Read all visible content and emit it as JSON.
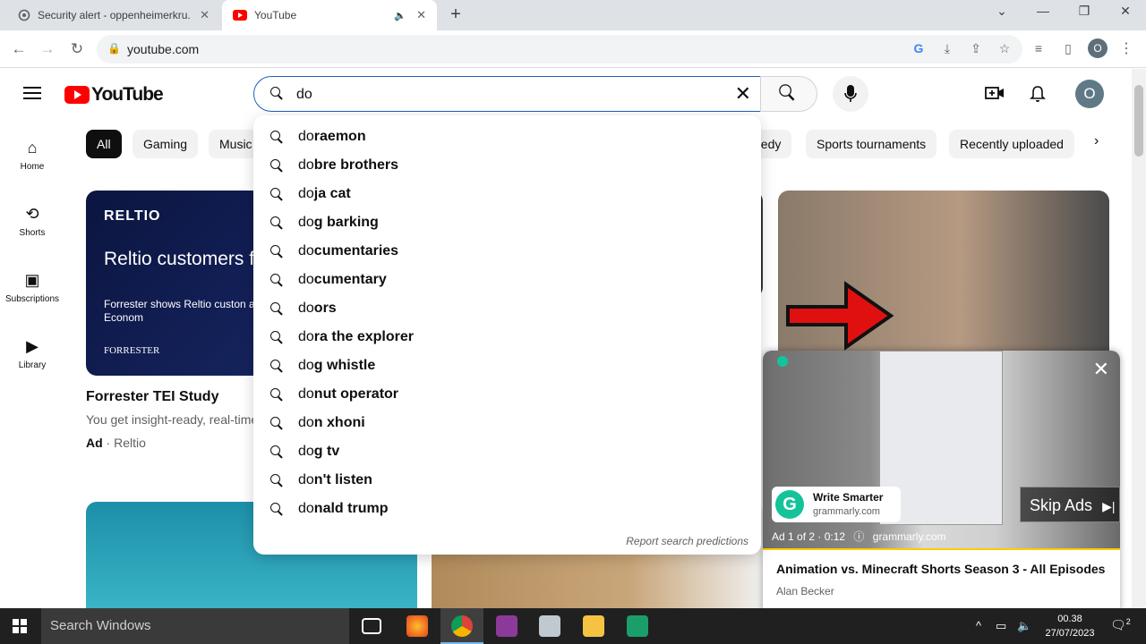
{
  "browser": {
    "tabs": [
      {
        "title": "Security alert - oppenheimerkru...",
        "active": false
      },
      {
        "title": "YouTube",
        "active": true
      }
    ],
    "url": "youtube.com",
    "profile_initial": "O"
  },
  "youtube": {
    "logo_text": "YouTube",
    "search_value": "do",
    "avatar_initial": "O",
    "sidenav": [
      {
        "label": "Home"
      },
      {
        "label": "Shorts"
      },
      {
        "label": "Subscriptions"
      },
      {
        "label": "Library"
      }
    ],
    "chips": [
      "All",
      "Gaming",
      "Music",
      "nedy",
      "Sports tournaments",
      "Recently uploaded"
    ],
    "suggestions": [
      {
        "prefix": "do",
        "rest": "raemon"
      },
      {
        "prefix": "do",
        "rest": "bre brothers"
      },
      {
        "prefix": "do",
        "rest": "ja cat"
      },
      {
        "prefix": "do",
        "rest": "g barking"
      },
      {
        "prefix": "do",
        "rest": "cumentaries"
      },
      {
        "prefix": "do",
        "rest": "cumentary"
      },
      {
        "prefix": "do",
        "rest": "ors"
      },
      {
        "prefix": "do",
        "rest": "ra the explorer"
      },
      {
        "prefix": "do",
        "rest": "g whistle"
      },
      {
        "prefix": "do",
        "rest": "nut operator"
      },
      {
        "prefix": "do",
        "rest": "n xhoni"
      },
      {
        "prefix": "do",
        "rest": "g tv"
      },
      {
        "prefix": "do",
        "rest": "n't listen"
      },
      {
        "prefix": "do",
        "rest": "nald trump"
      }
    ],
    "report_text": "Report search predictions",
    "ad_video": {
      "thumb_brand": "RELTIO",
      "thumb_headline": "Reltio customers from better accou",
      "thumb_sub": "Forrester shows Reltio custon and more in the Total Econom",
      "thumb_footer": "FORRESTER",
      "title": "Forrester TEI Study",
      "description": "You get insight-ready, real-time",
      "ad_label": "Ad",
      "advertiser": "Reltio"
    },
    "miniplayer": {
      "ad_brand": "Write Smarter",
      "ad_domain": "grammarly.com",
      "skip_label": "Skip Ads",
      "ad_info": "Ad 1 of 2 · 0:12",
      "ad_info_domain": "grammarly.com",
      "title": "Animation vs. Minecraft Shorts Season 3 - All Episodes (...",
      "channel": "Alan Becker",
      "progress": 0.0
    }
  },
  "taskbar": {
    "search_placeholder": "Search Windows",
    "time": "00.38",
    "date": "27/07/2023",
    "notification_count": "2"
  }
}
